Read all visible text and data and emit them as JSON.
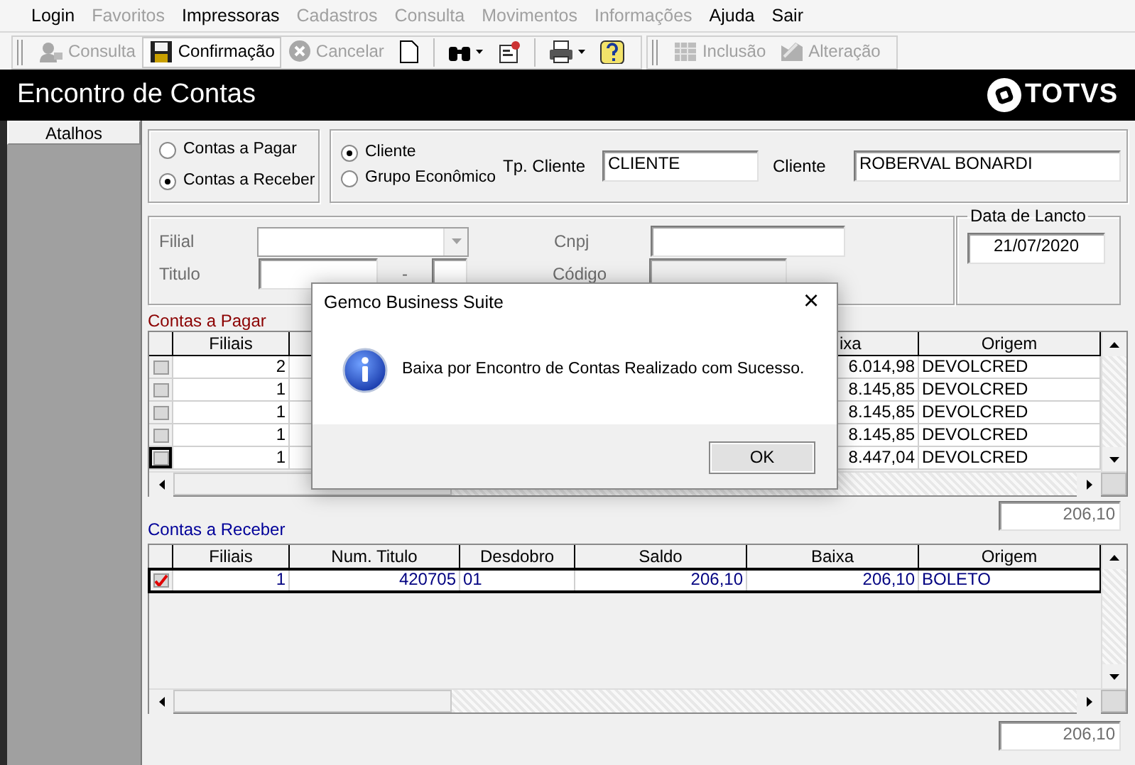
{
  "menu": [
    {
      "label": "Login",
      "disabled": false
    },
    {
      "label": "Favoritos",
      "disabled": true
    },
    {
      "label": "Impressoras",
      "disabled": false
    },
    {
      "label": "Cadastros",
      "disabled": true
    },
    {
      "label": "Consulta",
      "disabled": true
    },
    {
      "label": "Movimentos",
      "disabled": true
    },
    {
      "label": "Informações",
      "disabled": true
    },
    {
      "label": "Ajuda",
      "disabled": false
    },
    {
      "label": "Sair",
      "disabled": false
    }
  ],
  "toolbars": [
    [
      {
        "kind": "button",
        "label": "Consulta",
        "disabled": true,
        "highlighted": false
      },
      {
        "kind": "button",
        "label": "Confirmação",
        "disabled": false,
        "highlighted": true
      },
      {
        "kind": "button",
        "label": "Cancelar",
        "disabled": true,
        "highlighted": false
      },
      {
        "kind": "icon"
      },
      {
        "kind": "separator"
      },
      {
        "kind": "dropdown"
      },
      {
        "kind": "icon"
      },
      {
        "kind": "separator"
      },
      {
        "kind": "dropdown"
      },
      {
        "kind": "icon"
      }
    ],
    [
      {
        "kind": "button",
        "label": "Inclusão",
        "disabled": true,
        "highlighted": false
      },
      {
        "kind": "button",
        "label": "Alteração",
        "disabled": true,
        "highlighted": false
      }
    ]
  ],
  "header": {
    "title": "Encontro de Contas",
    "logo": "TOTVS"
  },
  "sidebar": {
    "button": "Atalhos"
  },
  "tipo_conta": [
    {
      "label": "Contas a Pagar",
      "selected": false
    },
    {
      "label": "Contas a Receber",
      "selected": true
    }
  ],
  "tipo_cliente": [
    {
      "label": "Cliente",
      "selected": true
    },
    {
      "label": "Grupo Econômico",
      "selected": false
    }
  ],
  "tp_cliente": {
    "label": "Tp. Cliente",
    "value": "CLIENTE"
  },
  "cliente": {
    "label": "Cliente",
    "value": "ROBERVAL BONARDI"
  },
  "filtro": {
    "filial": {
      "label": "Filial",
      "disabled": true
    },
    "cnpj": {
      "label": "Cnpj"
    },
    "titulo": {
      "label": "Titulo",
      "separator": "-"
    },
    "codigo": {
      "label": "Código",
      "disabled": true
    }
  },
  "data_lancto": {
    "legend": "Data de Lancto",
    "value": "21/07/2020"
  },
  "tables": [
    {
      "title": "Contas a Pagar",
      "columns": [
        "Filiais",
        null,
        null,
        null,
        "ixa",
        "Origem"
      ],
      "rows": [
        {
          "checked": false,
          "selected": false,
          "focused": false,
          "cells": [
            "2",
            null,
            null,
            null,
            "6.014,98",
            "DEVOLCRED"
          ]
        },
        {
          "checked": false,
          "selected": false,
          "focused": false,
          "cells": [
            "1",
            null,
            null,
            null,
            "8.145,85",
            "DEVOLCRED"
          ]
        },
        {
          "checked": false,
          "selected": false,
          "focused": false,
          "cells": [
            "1",
            null,
            null,
            null,
            "8.145,85",
            "DEVOLCRED"
          ]
        },
        {
          "checked": false,
          "selected": false,
          "focused": false,
          "cells": [
            "1",
            null,
            null,
            null,
            "8.145,85",
            "DEVOLCRED"
          ]
        },
        {
          "checked": false,
          "selected": false,
          "focused": true,
          "cells": [
            "1",
            null,
            null,
            null,
            "8.447,04",
            "DEVOLCRED"
          ]
        }
      ],
      "total": "206,10"
    },
    {
      "title": "Contas a Receber",
      "columns": [
        "Filiais",
        "Num. Titulo",
        "Desdobro",
        "Saldo",
        "Baixa",
        "Origem"
      ],
      "rows": [
        {
          "checked": true,
          "selected": true,
          "focused": false,
          "cells": [
            "1",
            "420705",
            "01",
            "206,10",
            "206,10",
            "BOLETO"
          ]
        }
      ],
      "total": "206,10"
    }
  ],
  "dialog": {
    "title": "Gemco Business Suite",
    "close": "×",
    "message": "Baixa por Encontro de Contas Realizado com Sucesso.",
    "button": "OK"
  }
}
